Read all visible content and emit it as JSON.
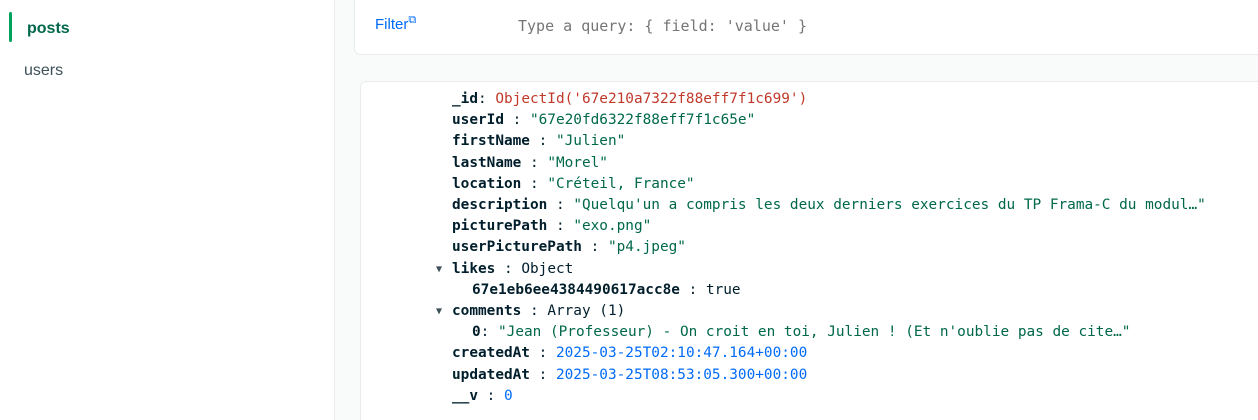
{
  "sidebar": {
    "items": [
      {
        "label": "posts"
      },
      {
        "label": "users"
      }
    ]
  },
  "filter": {
    "label": "Filter",
    "placeholder": "Type a query: { field: 'value' }"
  },
  "document": {
    "fields": [
      {
        "key": "_id",
        "sep": ": ",
        "value": "ObjectId('67e210a7322f88eff7f1c699')",
        "type": "oid"
      },
      {
        "key": "userId",
        "sep": " : ",
        "value": "\"67e20fd6322f88eff7f1c65e\"",
        "type": "str"
      },
      {
        "key": "firstName",
        "sep": " : ",
        "value": "\"Julien\"",
        "type": "str"
      },
      {
        "key": "lastName",
        "sep": " : ",
        "value": "\"Morel\"",
        "type": "str"
      },
      {
        "key": "location",
        "sep": " : ",
        "value": "\"Créteil, France\"",
        "type": "str"
      },
      {
        "key": "description",
        "sep": " : ",
        "value": "\"Quelqu'un a compris les deux derniers exercices du TP Frama-C du modul…\"",
        "type": "str"
      },
      {
        "key": "picturePath",
        "sep": " : ",
        "value": "\"exo.png\"",
        "type": "str"
      },
      {
        "key": "userPicturePath",
        "sep": " : ",
        "value": "\"p4.jpeg\"",
        "type": "str"
      },
      {
        "key": "likes",
        "sep": " : ",
        "value": "Object",
        "type": "plain",
        "expanded": true
      },
      {
        "key": "67e1eb6ee4384490617acc8e",
        "sep": " : ",
        "value": "true",
        "type": "plain",
        "nested": true
      },
      {
        "key": "comments",
        "sep": " : ",
        "value": "Array (1)",
        "type": "plain",
        "expanded": true
      },
      {
        "key": "0",
        "sep": ": ",
        "value": "\"Jean (Professeur) - On croit en toi, Julien ! (Et n'oublie pas de cite…\"",
        "type": "str",
        "nested": true
      },
      {
        "key": "createdAt",
        "sep": " : ",
        "value": "2025-03-25T02:10:47.164+00:00",
        "type": "num"
      },
      {
        "key": "updatedAt",
        "sep": " : ",
        "value": "2025-03-25T08:53:05.300+00:00",
        "type": "num"
      },
      {
        "key": "__v",
        "sep": " : ",
        "value": "0",
        "type": "num"
      }
    ]
  }
}
